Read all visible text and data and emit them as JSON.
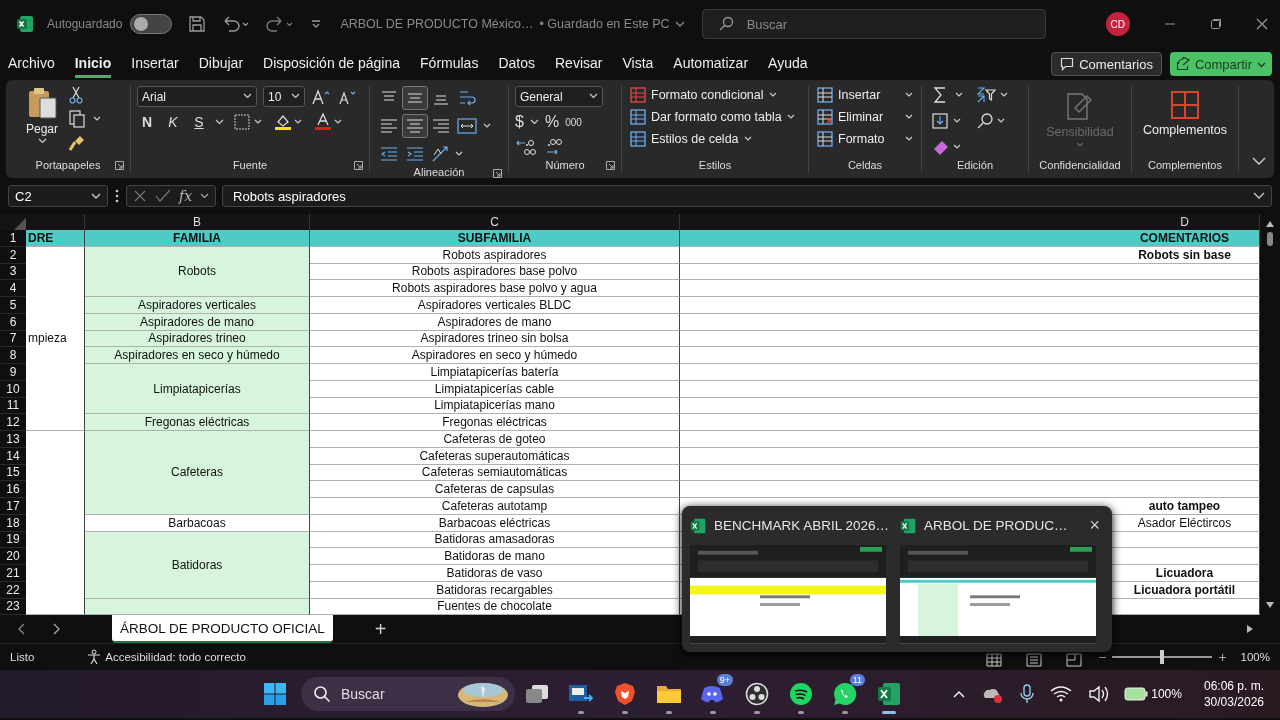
{
  "title_bar": {
    "autosave_label": "Autoguardado",
    "autosave_on": false,
    "document_title": "ARBOL DE PRODUCTO México…",
    "save_status": "• Guardado en Este PC",
    "search_placeholder": "Buscar",
    "avatar_initials": "CD"
  },
  "menu_tabs": [
    {
      "label": "Archivo",
      "selected": false
    },
    {
      "label": "Inicio",
      "selected": true
    },
    {
      "label": "Insertar",
      "selected": false
    },
    {
      "label": "Dibujar",
      "selected": false
    },
    {
      "label": "Disposición de página",
      "selected": false
    },
    {
      "label": "Fórmulas",
      "selected": false
    },
    {
      "label": "Datos",
      "selected": false
    },
    {
      "label": "Revisar",
      "selected": false
    },
    {
      "label": "Vista",
      "selected": false
    },
    {
      "label": "Automatizar",
      "selected": false
    },
    {
      "label": "Ayuda",
      "selected": false
    }
  ],
  "comments_button": "Comentarios",
  "share_button": "Compartir",
  "clipboard": {
    "paste": "Pegar",
    "label": "Portapapeles"
  },
  "font": {
    "family": "Arial",
    "size": "10",
    "bold": "N",
    "italic": "K",
    "underline": "S",
    "label": "Fuente"
  },
  "alignment": {
    "vertical_buttons": [
      {
        "selected": false
      },
      {
        "selected": true
      },
      {
        "selected": false
      }
    ],
    "horizontal_buttons": [
      {
        "selected": false
      },
      {
        "selected": true
      },
      {
        "selected": false
      }
    ],
    "label": "Alineación"
  },
  "number": {
    "format": "General",
    "currency": "$",
    "percent": "%",
    "thousands": "000",
    "label": "Número"
  },
  "styles": {
    "items": [
      "Formato condicional",
      "Dar formato como tabla",
      "Estilos de celda"
    ],
    "label": "Estilos"
  },
  "cells": {
    "items": [
      "Insertar",
      "Eliminar",
      "Formato"
    ],
    "label": "Celdas"
  },
  "editing": {
    "label": "Edición"
  },
  "sensitivity": {
    "button": "Sensibilidad",
    "disabled": true,
    "label": "Confidencialidad"
  },
  "addins": {
    "button": "Complementos",
    "label": "Complementos"
  },
  "formula_bar": {
    "name_box": "C2",
    "function_label": "fx",
    "value": "Robots aspiradores"
  },
  "sheet": {
    "row_numbers": [
      "1",
      "2",
      "3",
      "4",
      "5",
      "6",
      "7",
      "8",
      "9",
      "10",
      "11",
      "12",
      "13",
      "14",
      "15",
      "16",
      "17",
      "18",
      "19",
      "20",
      "21",
      "22",
      "23"
    ],
    "columns": [
      {
        "cells": [
          {
            "text": "DRE",
            "kind": "header",
            "bold": true
          },
          {
            "text": "mpieza",
            "kind": "plain",
            "bold": false
          },
          {
            "kind": "merged"
          },
          {
            "kind": "merged"
          },
          {
            "kind": "merged"
          },
          {
            "kind": "merged"
          },
          {
            "kind": "merged"
          },
          {
            "kind": "merged"
          },
          {
            "kind": "merged"
          },
          {
            "kind": "merged"
          },
          {
            "kind": "merged"
          },
          {
            "kind": "merged"
          },
          {
            "kind": "plain"
          },
          {
            "kind": "merged"
          },
          {
            "kind": "merged"
          },
          {
            "kind": "merged"
          },
          {
            "kind": "merged"
          },
          {
            "kind": "merged"
          },
          {
            "kind": "merged"
          },
          {
            "kind": "merged"
          },
          {
            "kind": "merged"
          },
          {
            "kind": "merged"
          },
          {
            "kind": "merged"
          }
        ]
      },
      {
        "header": "B",
        "cells": [
          {
            "text": "FAMILIA",
            "kind": "header",
            "bold": true
          },
          {
            "text": "Robots",
            "kind": "green",
            "bold": false
          },
          {
            "kind": "merged"
          },
          {
            "kind": "merged"
          },
          {
            "text": "Aspiradores verticales",
            "kind": "green",
            "bold": false
          },
          {
            "text": "Aspiradores de mano",
            "kind": "green",
            "bold": false
          },
          {
            "text": "Aspiradores trineo",
            "kind": "green",
            "bold": false
          },
          {
            "text": "Aspiradores en seco y húmedo",
            "kind": "green",
            "bold": false
          },
          {
            "text": "Limpiatapicerías",
            "kind": "green",
            "bold": false
          },
          {
            "kind": "merged"
          },
          {
            "kind": "merged"
          },
          {
            "text": "Fregonas eléctricas",
            "kind": "green",
            "bold": false
          },
          {
            "text": "Cafeteras",
            "kind": "green",
            "bold": false
          },
          {
            "kind": "merged"
          },
          {
            "kind": "merged"
          },
          {
            "kind": "merged"
          },
          {
            "kind": "merged"
          },
          {
            "text": "Barbacoas",
            "kind": "plain",
            "bold": false
          },
          {
            "text": "Batidoras",
            "kind": "green",
            "bold": false
          },
          {
            "kind": "merged"
          },
          {
            "kind": "merged"
          },
          {
            "kind": "merged"
          },
          {
            "kind": "green"
          }
        ]
      },
      {
        "header": "C",
        "cells": [
          {
            "text": "SUBFAMILIA",
            "kind": "header",
            "bold": true
          },
          {
            "text": "Robots aspiradores",
            "kind": "plain",
            "bold": false
          },
          {
            "text": "Robots aspiradores base polvo",
            "kind": "plain",
            "bold": false
          },
          {
            "text": "Robots aspiradores base polvo y agua",
            "kind": "plain",
            "bold": false
          },
          {
            "text": "Aspiradores verticales BLDC",
            "kind": "plain",
            "bold": false
          },
          {
            "text": "Aspiradores de mano",
            "kind": "plain",
            "bold": false
          },
          {
            "text": "Aspiradores trineo sin bolsa",
            "kind": "plain",
            "bold": false
          },
          {
            "text": "Aspiradores en seco y húmedo",
            "kind": "plain",
            "bold": false
          },
          {
            "text": "Limpiatapicerías batería",
            "kind": "plain",
            "bold": false
          },
          {
            "text": "Limpiatapicerías cable",
            "kind": "plain",
            "bold": false
          },
          {
            "text": "Limpiatapicerías mano",
            "kind": "plain",
            "bold": false
          },
          {
            "text": "Fregonas eléctricas",
            "kind": "plain",
            "bold": false
          },
          {
            "text": "Cafeteras de goteo",
            "kind": "plain",
            "bold": false
          },
          {
            "text": "Cafeteras superautomáticas",
            "kind": "plain",
            "bold": false
          },
          {
            "text": "Cafeteras semiautomáticas",
            "kind": "plain",
            "bold": false
          },
          {
            "text": "Cafeteras de capsulas",
            "kind": "plain",
            "bold": false
          },
          {
            "text": "Cafeteras autotamp",
            "kind": "plain",
            "bold": false
          },
          {
            "text": "Barbacoas eléctricas",
            "kind": "plain",
            "bold": false
          },
          {
            "text": "Batidoras amasadoras",
            "kind": "plain",
            "bold": false
          },
          {
            "text": "Batidoras de mano",
            "kind": "plain",
            "bold": false
          },
          {
            "text": "Batidoras de vaso",
            "kind": "plain",
            "bold": false
          },
          {
            "text": "Batidoras recargables",
            "kind": "plain",
            "bold": false
          },
          {
            "text": "Fuentes de chocolate",
            "kind": "plain",
            "bold": false
          }
        ]
      },
      {
        "header": "D",
        "cells": [
          {
            "text": "COMENTARIOS",
            "kind": "header",
            "bold": true
          },
          {
            "text": "Robots sin base",
            "kind": "plain",
            "bold": true
          },
          {
            "kind": "plain"
          },
          {
            "kind": "plain"
          },
          {
            "kind": "plain"
          },
          {
            "kind": "plain"
          },
          {
            "kind": "plain"
          },
          {
            "kind": "plain"
          },
          {
            "kind": "plain"
          },
          {
            "kind": "plain"
          },
          {
            "kind": "plain"
          },
          {
            "kind": "plain"
          },
          {
            "kind": "plain"
          },
          {
            "kind": "plain"
          },
          {
            "kind": "plain"
          },
          {
            "kind": "plain"
          },
          {
            "text": "auto tampeo",
            "kind": "plain",
            "bold": true
          },
          {
            "text": "Asador Eléctircos",
            "kind": "plain",
            "bold": false
          },
          {
            "kind": "plain"
          },
          {
            "kind": "plain"
          },
          {
            "text": "Licuadora",
            "kind": "plain",
            "bold": true
          },
          {
            "text": "Licuadora portátil",
            "kind": "plain",
            "bold": true
          },
          {
            "kind": "plain"
          }
        ]
      }
    ]
  },
  "sheet_tabs": [
    {
      "label": "ÁRBOL DE PRODUCTO OFICIAL",
      "selected": true
    }
  ],
  "add_sheet": "+",
  "status_bar": {
    "mode": "Listo",
    "accessibility": "Accesibilidad: todo correcto",
    "zoom_out": "−",
    "zoom_in": "+",
    "zoom": {
      "level": 0.5
    },
    "zoom_label": "100%"
  },
  "taskbar_preview": {
    "windows": [
      {
        "title": "BENCHMARK ABRIL 2026…",
        "kind": "yellow"
      },
      {
        "title": "ARBOL DE PRODUC…",
        "kind": "green",
        "close": "×"
      }
    ]
  },
  "taskbar": {
    "search_placeholder": "Buscar",
    "apps": [
      {
        "kind": "taskview"
      },
      {
        "kind": "vs",
        "running": true
      },
      {
        "kind": "brave",
        "running": true
      },
      {
        "kind": "folder",
        "running": true
      },
      {
        "kind": "discord",
        "running": true,
        "badge": "9+"
      },
      {
        "kind": "obs",
        "running": true
      },
      {
        "kind": "spotify",
        "running": true
      },
      {
        "kind": "whatsapp",
        "running": true,
        "badge": "11"
      },
      {
        "kind": "excel",
        "running": true
      }
    ],
    "battery": "100%",
    "time": "06:06 p. m.",
    "date": "30/03/2026"
  }
}
